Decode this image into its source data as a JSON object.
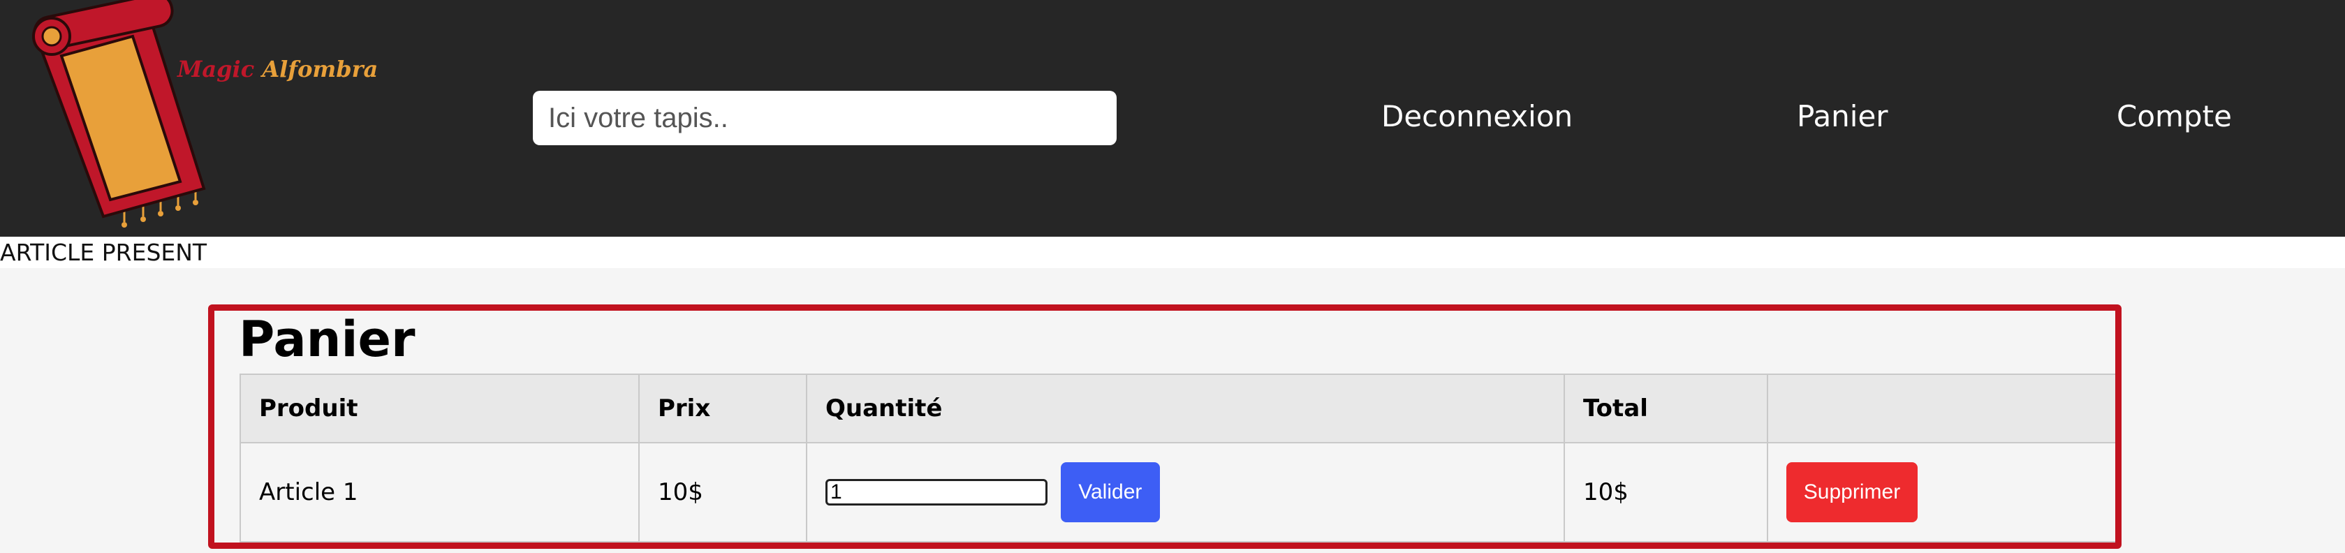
{
  "header": {
    "logo": {
      "word1": "Magic",
      "word2": "Alfombra",
      "colors": {
        "red": "#c0172a",
        "orange": "#e8a03a"
      }
    },
    "search": {
      "placeholder": "Ici votre tapis..",
      "value": ""
    },
    "nav": {
      "deconnexion": "Deconnexion",
      "panier": "Panier",
      "compte": "Compte"
    },
    "background": "#262626"
  },
  "notice": "ARTICLE PRESENT",
  "cart": {
    "title": "Panier",
    "columns": [
      "Produit",
      "Prix",
      "Quantité",
      "Total",
      ""
    ],
    "rows": [
      {
        "produit": "Article 1",
        "prix": "10$",
        "quantite": "1",
        "total": "10$"
      }
    ],
    "valider_label": "Valider",
    "supprimer_label": "Supprimer",
    "colors": {
      "border": "#c1121f",
      "valider": "#3d5ef5",
      "supprimer": "#ee2b2e"
    }
  }
}
